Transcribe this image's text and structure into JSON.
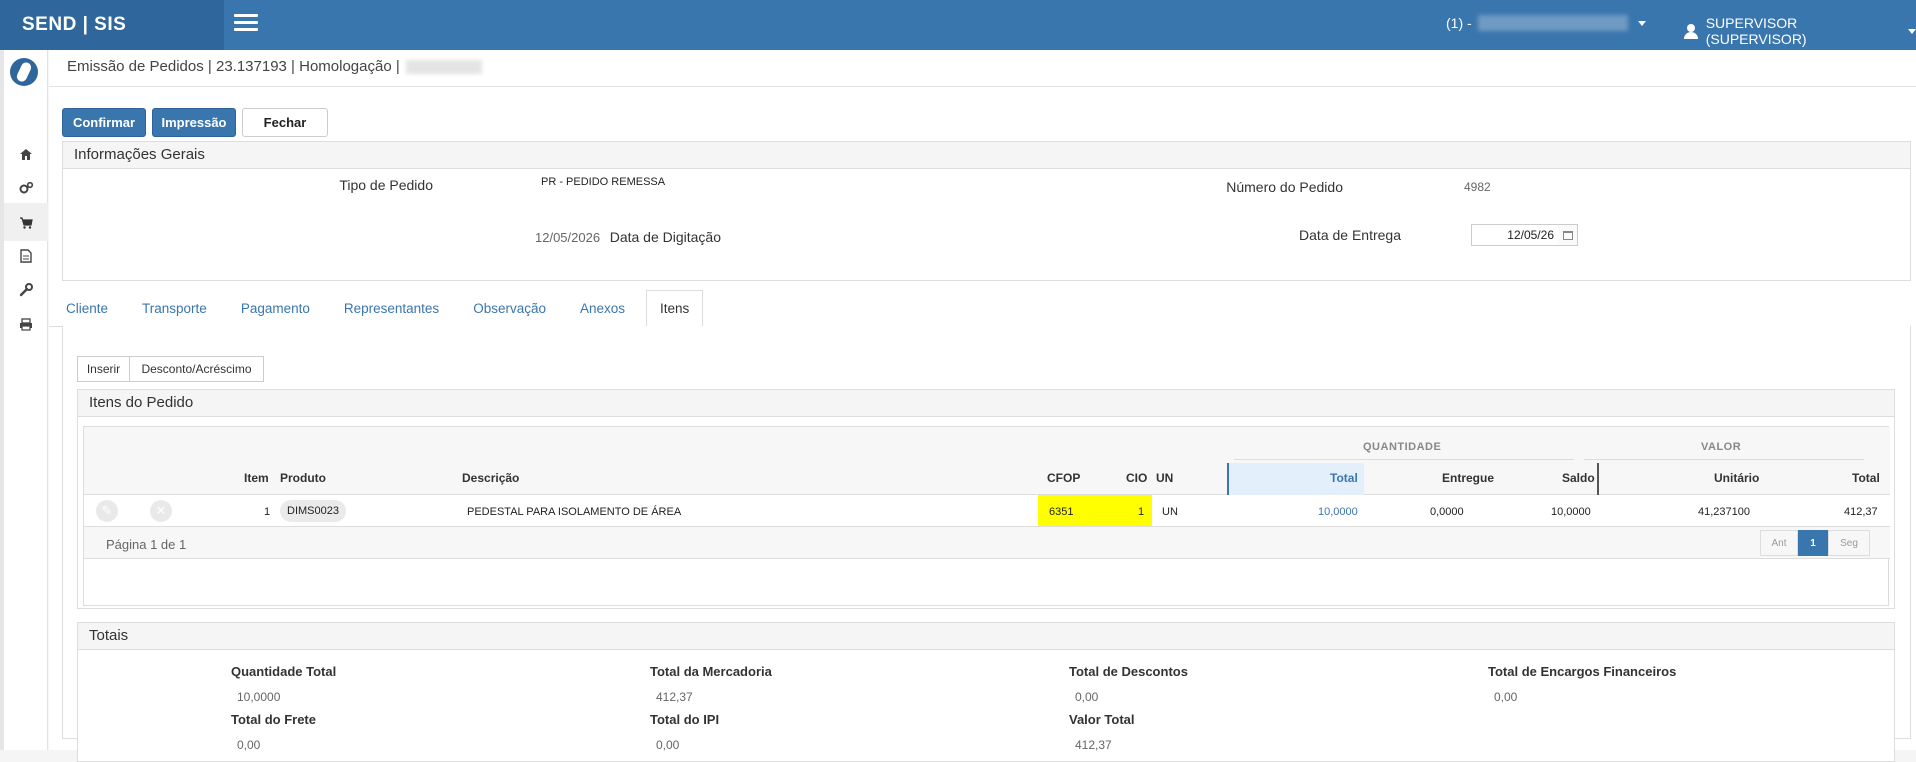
{
  "app": {
    "brand": "SEND | SIS",
    "company_prefix": "(1) -",
    "user": "SUPERVISOR (SUPERVISOR)"
  },
  "breadcrumb": "Emissão de Pedidos | 23.137193 | Homologação |",
  "actions": {
    "confirm": "Confirmar",
    "print": "Impressão",
    "close": "Fechar"
  },
  "general": {
    "title": "Informações Gerais",
    "order_type_label": "Tipo de Pedido",
    "order_type_value": "PR - PEDIDO REMESSA",
    "typing_date_label": "Data de Digitação",
    "typing_date_value": "12/05/2026",
    "order_number_label": "Número do Pedido",
    "order_number_value": "4982",
    "delivery_date_label": "Data de Entrega",
    "delivery_date_value": "12/05/26"
  },
  "tabs": [
    "Cliente",
    "Transporte",
    "Pagamento",
    "Representantes",
    "Observação",
    "Anexos",
    "Itens"
  ],
  "items_toolbar": {
    "insert": "Inserir",
    "discount": "Desconto/Acréscimo"
  },
  "items": {
    "title": "Itens do Pedido",
    "group_qty": "QUANTIDADE",
    "group_value": "VALOR",
    "headers": {
      "item": "Item",
      "product": "Produto",
      "description": "Descrição",
      "cfop": "CFOP",
      "cio": "CIO",
      "un": "UN",
      "total": "Total",
      "delivered": "Entregue",
      "balance": "Saldo",
      "unit": "Unitário",
      "value_total": "Total"
    },
    "rows": [
      {
        "item": "1",
        "product": "DIMS0023",
        "description": "PEDESTAL PARA ISOLAMENTO DE ÁREA",
        "cfop": "6351",
        "cio": "1",
        "un": "UN",
        "total": "10,0000",
        "delivered": "0,0000",
        "balance": "10,0000",
        "unit": "41,237100",
        "value_total": "412,37"
      }
    ],
    "page_info": "Página 1 de 1",
    "pager": {
      "prev": "Ant",
      "current": "1",
      "next": "Seg"
    }
  },
  "totals": {
    "title": "Totais",
    "qty_label": "Quantidade Total",
    "qty_value": "10,0000",
    "goods_label": "Total da Mercadoria",
    "goods_value": "412,37",
    "discount_label": "Total de Descontos",
    "discount_value": "0,00",
    "charges_label": "Total de Encargos Financeiros",
    "charges_value": "0,00",
    "freight_label": "Total do Frete",
    "freight_value": "0,00",
    "ipi_label": "Total do IPI",
    "ipi_value": "0,00",
    "grand_label": "Valor Total",
    "grand_value": "412,37"
  },
  "colors": {
    "primary": "#3a76ae",
    "highlight": "#ffff00",
    "qty_total_bg": "#e3effa"
  }
}
